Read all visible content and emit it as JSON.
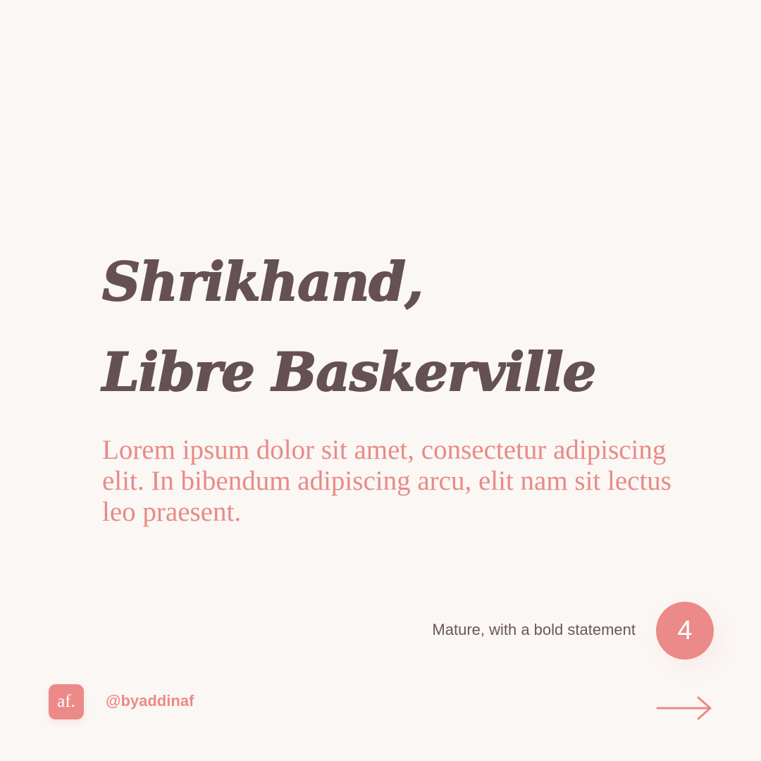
{
  "headline": {
    "line1": "Shrikhand,",
    "line2": "Libre Baskerville"
  },
  "body": {
    "text": "Lorem ipsum dolor sit amet, consectetur adipiscing elit. In bibendum adipiscing arcu, elit nam sit lectus leo praesent."
  },
  "caption": "Mature, with a bold statement",
  "slide_number": "4",
  "footer": {
    "logo_text": "af.",
    "handle": "@byaddinaf",
    "arrow_icon": "arrow-right-icon"
  },
  "colors": {
    "background": "#fbf7f4",
    "headline": "#655154",
    "accent": "#eb8a88",
    "caption": "#6b5558"
  }
}
